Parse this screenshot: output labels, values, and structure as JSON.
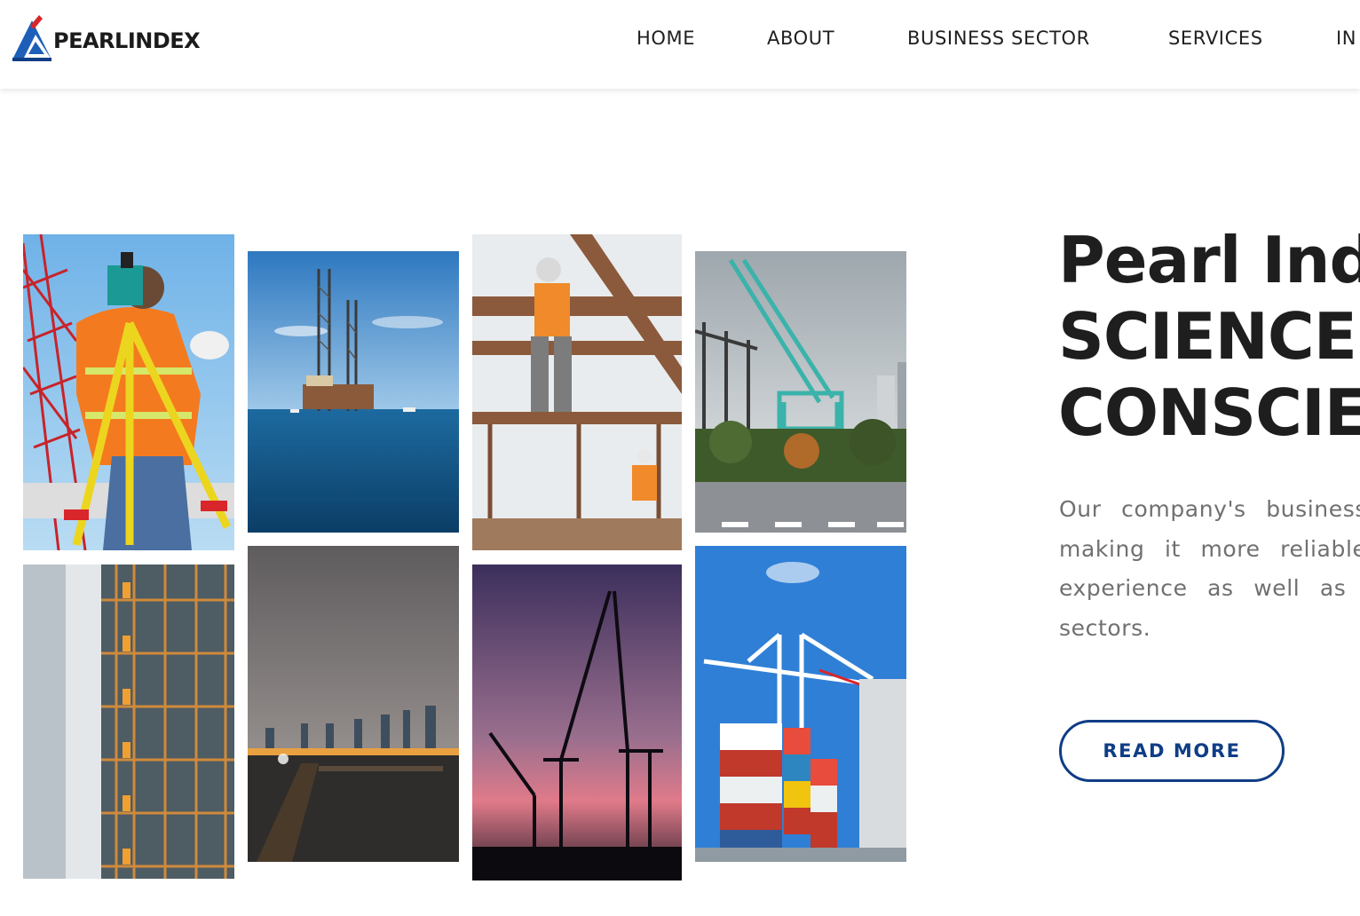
{
  "brand": {
    "name": "PEARLINDEX",
    "logo_icon": "triangle-a-logo",
    "colors": {
      "red": "#d8262b",
      "blue": "#1d5fb8",
      "navy": "#0f3d86"
    }
  },
  "nav": {
    "items": [
      {
        "label": "HOME"
      },
      {
        "label": "ABOUT"
      },
      {
        "label": "BUSINESS SECTOR"
      },
      {
        "label": "SERVICES"
      },
      {
        "label": "IN"
      }
    ]
  },
  "gallery": {
    "images": [
      {
        "subject": "surveyor-with-total-station"
      },
      {
        "subject": "offshore-oil-rig"
      },
      {
        "subject": "worker-on-steel-beams"
      },
      {
        "subject": "green-crane-industrial"
      },
      {
        "subject": "building-scaffold-workers"
      },
      {
        "subject": "city-skyline-night-pier"
      },
      {
        "subject": "port-cranes-sunset"
      },
      {
        "subject": "container-port-crane"
      }
    ]
  },
  "hero": {
    "title_lines": [
      "Pearl Inde",
      "SCIENCE W",
      "CONSCIEN"
    ],
    "body_lines": [
      "Our company's business is",
      "making it more reliable",
      "experience as well as u",
      "sectors."
    ],
    "button_label": "READ MORE"
  }
}
